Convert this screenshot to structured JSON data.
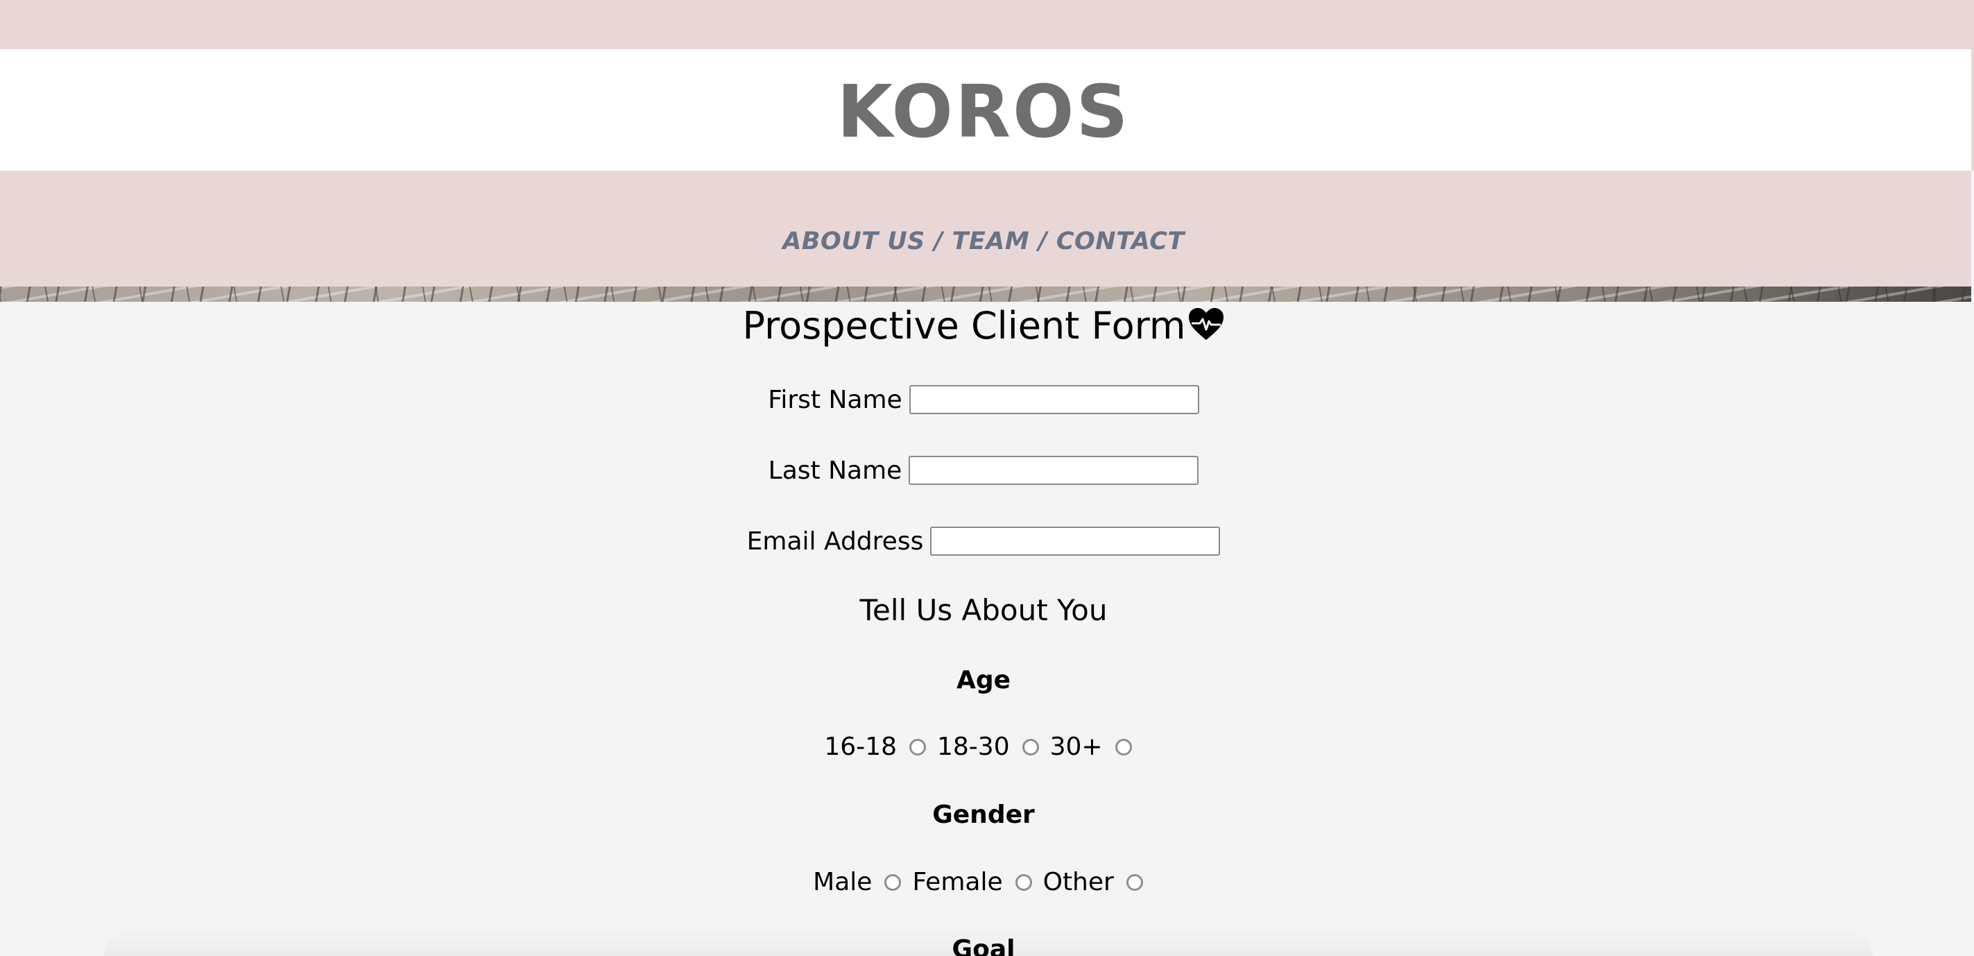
{
  "header": {
    "brand": "KOROS",
    "nav": "ABOUT US / TEAM / CONTACT"
  },
  "form": {
    "title": "Prospective Client Form",
    "title_icon": "heartbeat-icon",
    "fields": [
      {
        "label": "First Name",
        "value": ""
      },
      {
        "label": "Last Name",
        "value": ""
      },
      {
        "label": "Email Address",
        "value": ""
      }
    ],
    "about_heading": "Tell Us About You",
    "age": {
      "heading": "Age",
      "options": [
        "16-18",
        "18-30",
        "30+"
      ]
    },
    "gender": {
      "heading": "Gender",
      "options": [
        "Male",
        "Female",
        "Other"
      ]
    },
    "goal": {
      "heading": "Goal"
    }
  },
  "colors": {
    "band": "#e9d7d8",
    "brand_text": "#6f6f6f",
    "nav_text": "#6a7385",
    "page_bg": "#f4f4f4"
  }
}
